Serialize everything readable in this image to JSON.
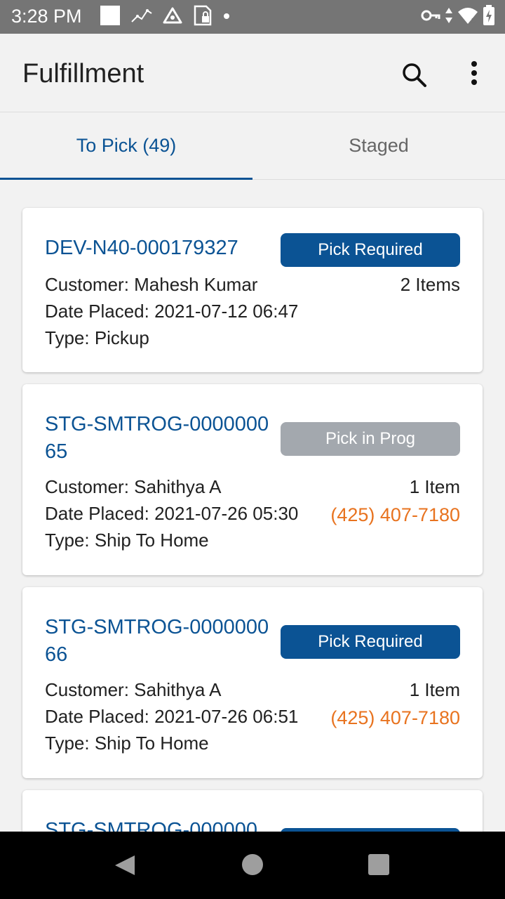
{
  "status_bar": {
    "time": "3:28 PM",
    "icons": [
      "white-square-icon",
      "activity-graph-icon",
      "triangle-alert-icon",
      "sim-lock-icon",
      "dot-icon",
      "key-icon",
      "data-arrows-icon",
      "wifi-icon",
      "battery-charging-icon"
    ]
  },
  "app_bar": {
    "title": "Fulfillment",
    "actions": [
      "search-icon",
      "more-vert-icon"
    ]
  },
  "tabs": [
    {
      "label": "To Pick (49)",
      "active": true
    },
    {
      "label": "Staged",
      "active": false
    }
  ],
  "orders": [
    {
      "id": "DEV-N40-000179327",
      "status": "Pick Required",
      "customer": "Customer: Mahesh Kumar",
      "items": "2 Items",
      "date": "Date Placed: 2021-07-12 06:47",
      "type": "Type: Pickup",
      "phone": ""
    },
    {
      "id": "STG-SMTROG-000000065",
      "status": "Pick in Prog",
      "customer": "Customer: Sahithya A",
      "items": "1 Item",
      "date": "Date Placed: 2021-07-26 05:30",
      "type": "Type: Ship To Home",
      "phone": "(425) 407-7180"
    },
    {
      "id": "STG-SMTROG-000000066",
      "status": "Pick Required",
      "customer": "Customer: Sahithya A",
      "items": "1 Item",
      "date": "Date Placed: 2021-07-26 06:51",
      "type": "Type: Ship To Home",
      "phone": "(425) 407-7180"
    },
    {
      "id": "STG-SMTROG-000000",
      "status": "",
      "customer": "",
      "items": "",
      "date": "",
      "type": "",
      "phone": ""
    }
  ],
  "colors": {
    "accent": "#0b5394",
    "phone": "#e8731f",
    "badge_in_progress": "#a3a8ae"
  },
  "nav_bar": [
    "back-icon",
    "home-icon",
    "recents-icon"
  ]
}
